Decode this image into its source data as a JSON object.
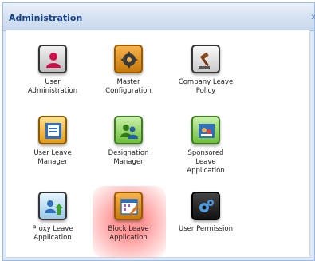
{
  "window": {
    "title": "Administration",
    "close_glyph": "x"
  },
  "tiles": [
    {
      "label": "User\nAdministration",
      "icon": "user-admin-icon"
    },
    {
      "label": "Master\nConfiguration",
      "icon": "gear-icon"
    },
    {
      "label": "Company Leave\nPolicy",
      "icon": "gavel-icon"
    },
    {
      "label": "User Leave\nManager",
      "icon": "leave-manager-icon"
    },
    {
      "label": "Designation\nManager",
      "icon": "designation-icon"
    },
    {
      "label": "Sponsored\nLeave\nApplication",
      "icon": "sponsored-leave-icon"
    },
    {
      "label": "Proxy Leave\nApplication",
      "icon": "proxy-leave-icon"
    },
    {
      "label": "Block Leave\nApplication",
      "icon": "block-leave-icon"
    },
    {
      "label": "User Permission",
      "icon": "permission-icon"
    }
  ],
  "highlighted_tile": "Block Leave Application",
  "colors": {
    "title_text": "#15428b",
    "panel_border": "#99bbe8",
    "highlight": "#ff8c8c"
  }
}
